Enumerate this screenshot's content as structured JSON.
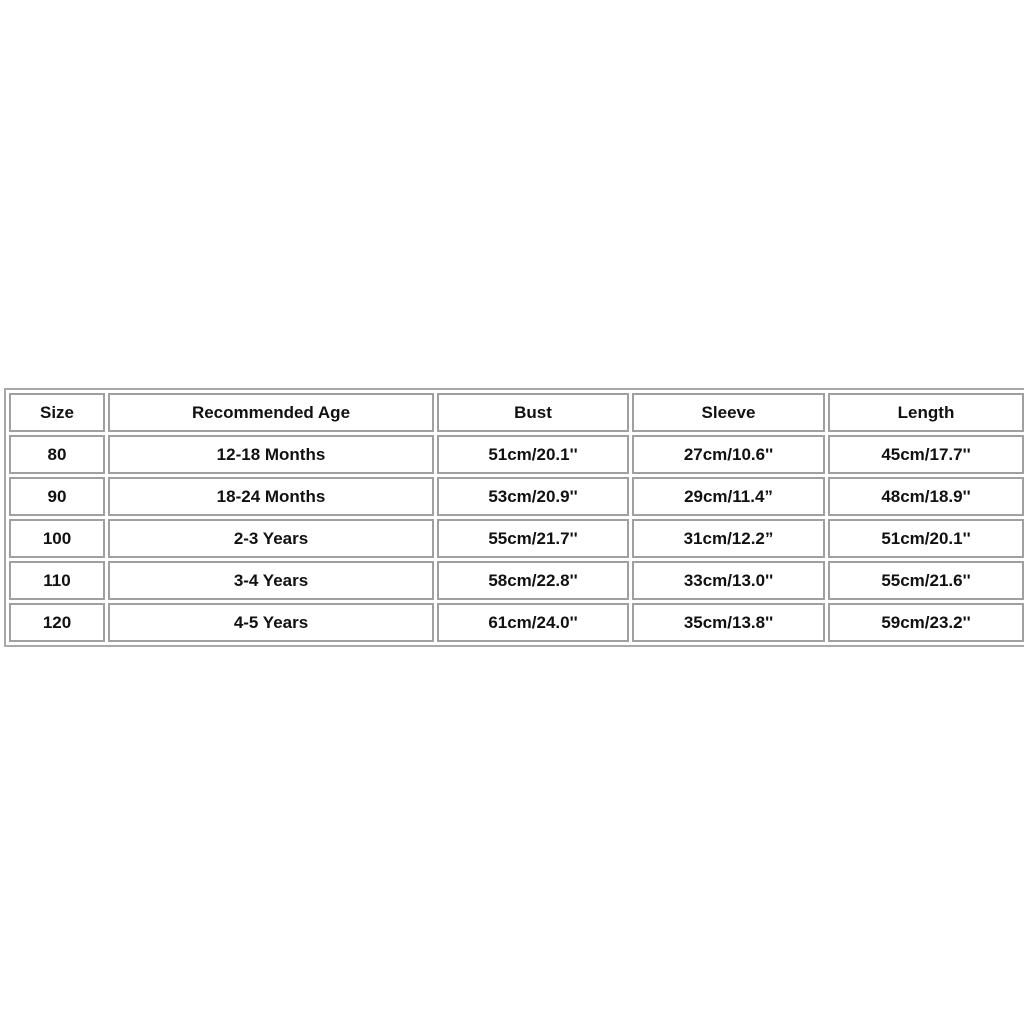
{
  "table": {
    "headers": [
      "Size",
      "Recommended Age",
      "Bust",
      "Sleeve",
      "Length"
    ],
    "rows": [
      [
        "80",
        "12-18 Months",
        "51cm/20.1''",
        "27cm/10.6''",
        "45cm/17.7''"
      ],
      [
        "90",
        "18-24 Months",
        "53cm/20.9''",
        "29cm/11.4”",
        "48cm/18.9''"
      ],
      [
        "100",
        "2-3 Years",
        "55cm/21.7''",
        "31cm/12.2”",
        "51cm/20.1''"
      ],
      [
        "110",
        "3-4 Years",
        "58cm/22.8''",
        "33cm/13.0''",
        "55cm/21.6''"
      ],
      [
        "120",
        "4-5 Years",
        "61cm/24.0''",
        "35cm/13.8''",
        "59cm/23.2''"
      ]
    ]
  }
}
